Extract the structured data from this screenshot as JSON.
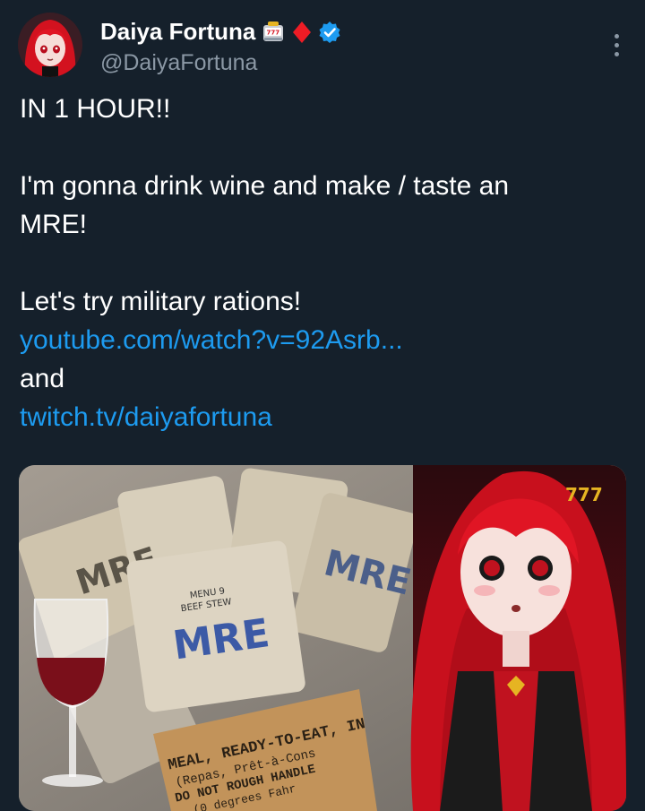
{
  "tweet": {
    "author": {
      "display_name": "Daiya Fortuna",
      "handle": "@DaiyaFortuna",
      "badges": [
        "slot-machine-icon",
        "red-diamond-icon",
        "verified-badge-icon"
      ]
    },
    "lines": [
      "IN 1 HOUR!!",
      "",
      "I'm gonna drink wine and make / taste an",
      "MRE!",
      "",
      "Let's try military rations!"
    ],
    "link1": "youtube.com/watch?v=92Asrb...",
    "connector": "and",
    "link2": "twitch.tv/daiyafortuna",
    "media": {
      "mre_menu": "MENU 9",
      "mre_item": "BEEF STEW",
      "mre_logo": "MRE",
      "box_line1": "MEAL, READY-TO-EAT, IN",
      "box_line2": "(Repas, Prêt-à-Cons",
      "box_line3": "DO NOT ROUGH HANDLE",
      "box_line4": "(0 degrees Fahr"
    }
  },
  "colors": {
    "background": "#15202b",
    "link": "#1d9bf0",
    "secondary_text": "#8b98a5",
    "verified": "#1d9bf0"
  }
}
